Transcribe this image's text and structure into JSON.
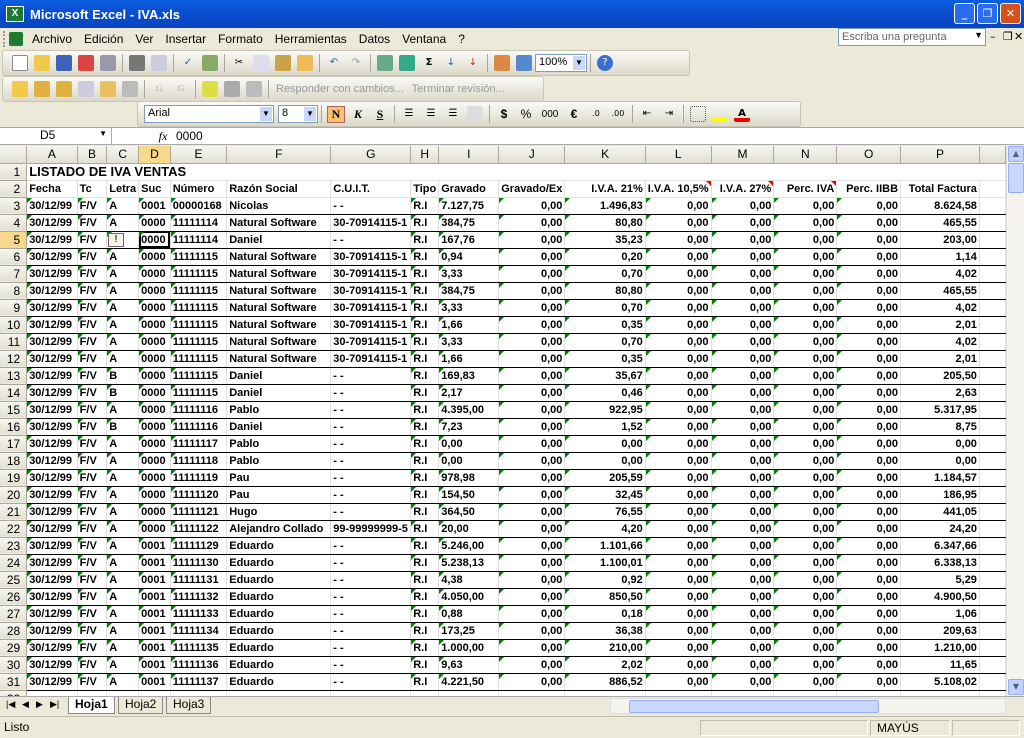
{
  "window": {
    "title": "Microsoft Excel - IVA.xls",
    "app_icon": "excel-icon"
  },
  "menu": [
    "Archivo",
    "Edición",
    "Ver",
    "Insertar",
    "Formato",
    "Herramientas",
    "Datos",
    "Ventana",
    "?"
  ],
  "help_box": {
    "placeholder": "Escriba una pregunta"
  },
  "toolbar": {
    "zoom": "100%",
    "review_reply": "Responder con cambios...",
    "review_end": "Terminar revisión..."
  },
  "format": {
    "font": "Arial",
    "size": "8",
    "bold": "N",
    "italic": "K",
    "underline": "S",
    "currency": "$",
    "percent": "%",
    "thousands": "000",
    "euro": "€"
  },
  "formula_bar": {
    "name_box": "D5",
    "fx": "fx",
    "value": "0000"
  },
  "columns": [
    "A",
    "B",
    "C",
    "D",
    "E",
    "F",
    "G",
    "H",
    "I",
    "J",
    "K",
    "L",
    "M",
    "N",
    "O",
    "P"
  ],
  "sheet": {
    "title": "LISTADO DE IVA VENTAS",
    "headers": [
      "Fecha",
      "Tc",
      "Letra",
      "Suc",
      "Número",
      "Razón Social",
      "C.U.I.T.",
      "Tipo",
      "Gravado",
      "Gravado/Ex",
      "I.V.A. 21%",
      "I.V.A. 10,5%",
      "I.V.A. 27%",
      "Perc. IVA",
      "Perc. IIBB",
      "Total Factura"
    ],
    "rows": [
      [
        "30/12/99",
        "F/V",
        "A",
        "0001",
        "00000168",
        "Nicolas",
        "-     -",
        "R.I",
        "7.127,75",
        "0,00",
        "1.496,83",
        "0,00",
        "0,00",
        "0,00",
        "0,00",
        "8.624,58"
      ],
      [
        "30/12/99",
        "F/V",
        "A",
        "0000",
        "11111114",
        "Natural Software",
        "30-70914115-1",
        "R.I",
        "384,75",
        "0,00",
        "80,80",
        "0,00",
        "0,00",
        "0,00",
        "0,00",
        "465,55"
      ],
      [
        "30/12/99",
        "F/V",
        "",
        "0000",
        "11111114",
        "Daniel",
        "-     -",
        "R.I",
        "167,76",
        "0,00",
        "35,23",
        "0,00",
        "0,00",
        "0,00",
        "0,00",
        "203,00"
      ],
      [
        "30/12/99",
        "F/V",
        "A",
        "0000",
        "11111115",
        "Natural Software",
        "30-70914115-1",
        "R.I",
        "0,94",
        "0,00",
        "0,20",
        "0,00",
        "0,00",
        "0,00",
        "0,00",
        "1,14"
      ],
      [
        "30/12/99",
        "F/V",
        "A",
        "0000",
        "11111115",
        "Natural Software",
        "30-70914115-1",
        "R.I",
        "3,33",
        "0,00",
        "0,70",
        "0,00",
        "0,00",
        "0,00",
        "0,00",
        "4,02"
      ],
      [
        "30/12/99",
        "F/V",
        "A",
        "0000",
        "11111115",
        "Natural Software",
        "30-70914115-1",
        "R.I",
        "384,75",
        "0,00",
        "80,80",
        "0,00",
        "0,00",
        "0,00",
        "0,00",
        "465,55"
      ],
      [
        "30/12/99",
        "F/V",
        "A",
        "0000",
        "11111115",
        "Natural Software",
        "30-70914115-1",
        "R.I",
        "3,33",
        "0,00",
        "0,70",
        "0,00",
        "0,00",
        "0,00",
        "0,00",
        "4,02"
      ],
      [
        "30/12/99",
        "F/V",
        "A",
        "0000",
        "11111115",
        "Natural Software",
        "30-70914115-1",
        "R.I",
        "1,66",
        "0,00",
        "0,35",
        "0,00",
        "0,00",
        "0,00",
        "0,00",
        "2,01"
      ],
      [
        "30/12/99",
        "F/V",
        "A",
        "0000",
        "11111115",
        "Natural Software",
        "30-70914115-1",
        "R.I",
        "3,33",
        "0,00",
        "0,70",
        "0,00",
        "0,00",
        "0,00",
        "0,00",
        "4,02"
      ],
      [
        "30/12/99",
        "F/V",
        "A",
        "0000",
        "11111115",
        "Natural Software",
        "30-70914115-1",
        "R.I",
        "1,66",
        "0,00",
        "0,35",
        "0,00",
        "0,00",
        "0,00",
        "0,00",
        "2,01"
      ],
      [
        "30/12/99",
        "F/V",
        "B",
        "0000",
        "11111115",
        "Daniel",
        "-     -",
        "R.I",
        "169,83",
        "0,00",
        "35,67",
        "0,00",
        "0,00",
        "0,00",
        "0,00",
        "205,50"
      ],
      [
        "30/12/99",
        "F/V",
        "B",
        "0000",
        "11111115",
        "Daniel",
        "-     -",
        "R.I",
        "2,17",
        "0,00",
        "0,46",
        "0,00",
        "0,00",
        "0,00",
        "0,00",
        "2,63"
      ],
      [
        "30/12/99",
        "F/V",
        "A",
        "0000",
        "11111116",
        "Pablo",
        "-     -",
        "R.I",
        "4.395,00",
        "0,00",
        "922,95",
        "0,00",
        "0,00",
        "0,00",
        "0,00",
        "5.317,95"
      ],
      [
        "30/12/99",
        "F/V",
        "B",
        "0000",
        "11111116",
        "Daniel",
        "-     -",
        "R.I",
        "7,23",
        "0,00",
        "1,52",
        "0,00",
        "0,00",
        "0,00",
        "0,00",
        "8,75"
      ],
      [
        "30/12/99",
        "F/V",
        "A",
        "0000",
        "11111117",
        "Pablo",
        "-     -",
        "R.I",
        "0,00",
        "0,00",
        "0,00",
        "0,00",
        "0,00",
        "0,00",
        "0,00",
        "0,00"
      ],
      [
        "30/12/99",
        "F/V",
        "A",
        "0000",
        "11111118",
        "Pablo",
        "-     -",
        "R.I",
        "0,00",
        "0,00",
        "0,00",
        "0,00",
        "0,00",
        "0,00",
        "0,00",
        "0,00"
      ],
      [
        "30/12/99",
        "F/V",
        "A",
        "0000",
        "11111119",
        "Pau",
        "-     -",
        "R.I",
        "978,98",
        "0,00",
        "205,59",
        "0,00",
        "0,00",
        "0,00",
        "0,00",
        "1.184,57"
      ],
      [
        "30/12/99",
        "F/V",
        "A",
        "0000",
        "11111120",
        "Pau",
        "-     -",
        "R.I",
        "154,50",
        "0,00",
        "32,45",
        "0,00",
        "0,00",
        "0,00",
        "0,00",
        "186,95"
      ],
      [
        "30/12/99",
        "F/V",
        "A",
        "0000",
        "11111121",
        "Hugo",
        "-     -",
        "R.I",
        "364,50",
        "0,00",
        "76,55",
        "0,00",
        "0,00",
        "0,00",
        "0,00",
        "441,05"
      ],
      [
        "30/12/99",
        "F/V",
        "A",
        "0000",
        "11111122",
        "Alejandro Collado",
        "99-99999999-5",
        "R.I",
        "20,00",
        "0,00",
        "4,20",
        "0,00",
        "0,00",
        "0,00",
        "0,00",
        "24,20"
      ],
      [
        "30/12/99",
        "F/V",
        "A",
        "0001",
        "11111129",
        "Eduardo",
        "-     -",
        "R.I",
        "5.246,00",
        "0,00",
        "1.101,66",
        "0,00",
        "0,00",
        "0,00",
        "0,00",
        "6.347,66"
      ],
      [
        "30/12/99",
        "F/V",
        "A",
        "0001",
        "11111130",
        "Eduardo",
        "-     -",
        "R.I",
        "5.238,13",
        "0,00",
        "1.100,01",
        "0,00",
        "0,00",
        "0,00",
        "0,00",
        "6.338,13"
      ],
      [
        "30/12/99",
        "F/V",
        "A",
        "0001",
        "11111131",
        "Eduardo",
        "-     -",
        "R.I",
        "4,38",
        "0,00",
        "0,92",
        "0,00",
        "0,00",
        "0,00",
        "0,00",
        "5,29"
      ],
      [
        "30/12/99",
        "F/V",
        "A",
        "0001",
        "11111132",
        "Eduardo",
        "-     -",
        "R.I",
        "4.050,00",
        "0,00",
        "850,50",
        "0,00",
        "0,00",
        "0,00",
        "0,00",
        "4.900,50"
      ],
      [
        "30/12/99",
        "F/V",
        "A",
        "0001",
        "11111133",
        "Eduardo",
        "-     -",
        "R.I",
        "0,88",
        "0,00",
        "0,18",
        "0,00",
        "0,00",
        "0,00",
        "0,00",
        "1,06"
      ],
      [
        "30/12/99",
        "F/V",
        "A",
        "0001",
        "11111134",
        "Eduardo",
        "-     -",
        "R.I",
        "173,25",
        "0,00",
        "36,38",
        "0,00",
        "0,00",
        "0,00",
        "0,00",
        "209,63"
      ],
      [
        "30/12/99",
        "F/V",
        "A",
        "0001",
        "11111135",
        "Eduardo",
        "-     -",
        "R.I",
        "1.000,00",
        "0,00",
        "210,00",
        "0,00",
        "0,00",
        "0,00",
        "0,00",
        "1.210,00"
      ],
      [
        "30/12/99",
        "F/V",
        "A",
        "0001",
        "11111136",
        "Eduardo",
        "-     -",
        "R.I",
        "9,63",
        "0,00",
        "2,02",
        "0,00",
        "0,00",
        "0,00",
        "0,00",
        "11,65"
      ],
      [
        "30/12/99",
        "F/V",
        "A",
        "0001",
        "11111137",
        "Eduardo",
        "-     -",
        "R.I",
        "4.221,50",
        "0,00",
        "886,52",
        "0,00",
        "0,00",
        "0,00",
        "0,00",
        "5.108,02"
      ]
    ]
  },
  "tabs": [
    "Hoja1",
    "Hoja2",
    "Hoja3"
  ],
  "status": {
    "left": "Listo",
    "caps": "MAYÚS"
  },
  "colors": {
    "titlebar": "#0b4fd1",
    "selected_header": "#f8d88a",
    "error_triangle": "#008000",
    "comment_marker": "#e00000"
  }
}
